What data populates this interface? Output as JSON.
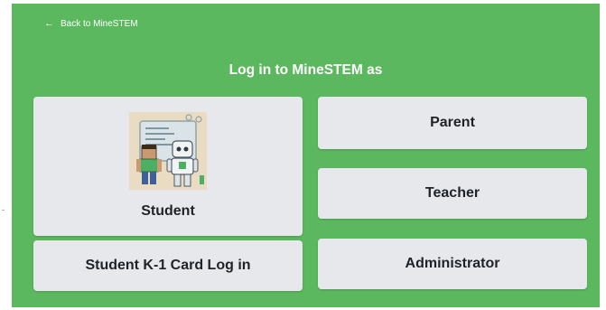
{
  "header": {
    "back_label": "Back to MineSTEM",
    "title": "Log in to MineSTEM as"
  },
  "options": {
    "student": "Student",
    "student_k1": "Student K-1 Card Log in",
    "parent": "Parent",
    "teacher": "Teacher",
    "administrator": "Administrator"
  },
  "icons": {
    "back": "arrow-left-icon",
    "student_illustration": "student-and-robot-illustration"
  },
  "colors": {
    "background": "#5cb85f",
    "card": "#e6e8ec",
    "text": "#1f2328",
    "header_text": "#ffffff"
  }
}
